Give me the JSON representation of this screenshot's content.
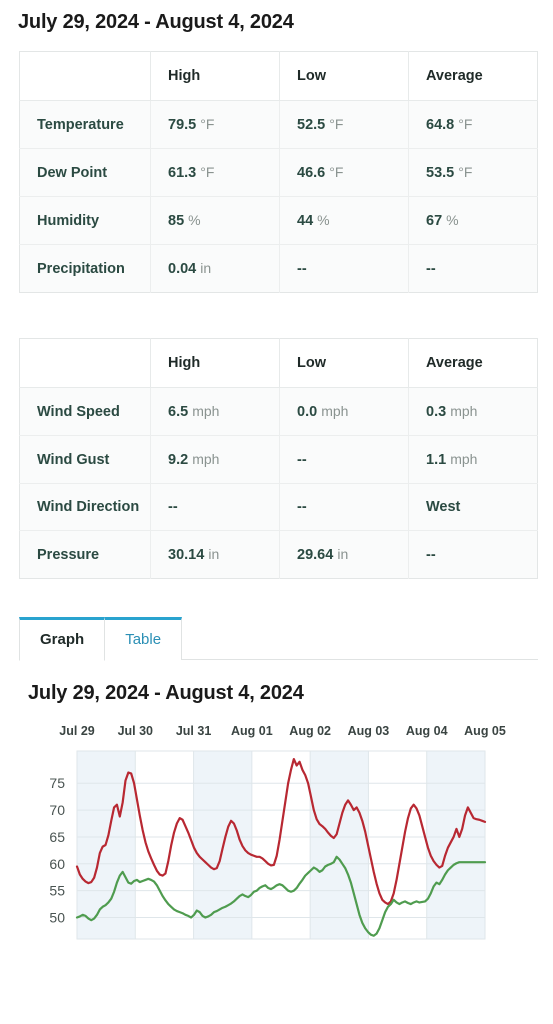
{
  "header": {
    "date_range": "July 29, 2024 - August 4, 2024"
  },
  "summary_table": {
    "columns": [
      "",
      "High",
      "Low",
      "Average"
    ],
    "rows": [
      {
        "label": "Temperature",
        "high_num": "79.5",
        "high_unit": "°F",
        "low_num": "52.5",
        "low_unit": "°F",
        "avg_num": "64.8",
        "avg_unit": "°F"
      },
      {
        "label": "Dew Point",
        "high_num": "61.3",
        "high_unit": "°F",
        "low_num": "46.6",
        "low_unit": "°F",
        "avg_num": "53.5",
        "avg_unit": "°F"
      },
      {
        "label": "Humidity",
        "high_num": "85",
        "high_unit": "%",
        "low_num": "44",
        "low_unit": "%",
        "avg_num": "67",
        "avg_unit": "%"
      },
      {
        "label": "Precipitation",
        "high_num": "0.04",
        "high_unit": "in",
        "low_num": "--",
        "low_unit": "",
        "avg_num": "--",
        "avg_unit": ""
      }
    ]
  },
  "wind_table": {
    "columns": [
      "",
      "High",
      "Low",
      "Average"
    ],
    "rows": [
      {
        "label": "Wind Speed",
        "high_num": "6.5",
        "high_unit": "mph",
        "low_num": "0.0",
        "low_unit": "mph",
        "avg_num": "0.3",
        "avg_unit": "mph"
      },
      {
        "label": "Wind Gust",
        "high_num": "9.2",
        "high_unit": "mph",
        "low_num": "--",
        "low_unit": "",
        "avg_num": "1.1",
        "avg_unit": "mph"
      },
      {
        "label": "Wind Direction",
        "high_num": "--",
        "high_unit": "",
        "low_num": "--",
        "low_unit": "",
        "avg_num": "West",
        "avg_unit": ""
      },
      {
        "label": "Pressure",
        "high_num": "30.14",
        "high_unit": "in",
        "low_num": "29.64",
        "low_unit": "in",
        "avg_num": "--",
        "avg_unit": ""
      }
    ]
  },
  "tabs": {
    "items": [
      {
        "label": "Graph",
        "active": true
      },
      {
        "label": "Table",
        "active": false
      }
    ],
    "accent_color": "#29a3cf"
  },
  "chart_data": {
    "type": "line",
    "title": "July 29, 2024 - August 4, 2024",
    "xlabel": "",
    "ylabel": "",
    "grid": true,
    "legend_position": "none",
    "axis_labels_position": "top",
    "xlim": [
      0,
      7
    ],
    "ylim": [
      46,
      81
    ],
    "yticks": [
      50,
      55,
      60,
      65,
      70,
      75
    ],
    "xtick_labels": [
      "Jul 29",
      "Jul 30",
      "Jul 31",
      "Aug 01",
      "Aug 02",
      "Aug 03",
      "Aug 04",
      "Aug 05"
    ],
    "day_band_count": 7,
    "series": [
      {
        "name": "Temperature",
        "color": "#b82832",
        "unit": "°F",
        "values": [
          59.5,
          58.0,
          57.2,
          56.7,
          56.4,
          56.6,
          57.4,
          59.3,
          62.0,
          63.2,
          63.5,
          65.3,
          68.0,
          70.5,
          71.0,
          68.8,
          71.4,
          75.5,
          77.0,
          76.8,
          75.0,
          72.0,
          69.0,
          66.3,
          64.0,
          62.3,
          61.0,
          59.8,
          58.7,
          58.0,
          57.8,
          58.2,
          60.5,
          63.4,
          65.8,
          67.5,
          68.5,
          68.2,
          67.0,
          65.8,
          64.4,
          63.0,
          62.0,
          61.3,
          60.8,
          60.3,
          59.8,
          59.3,
          59.0,
          59.2,
          60.5,
          62.8,
          65.0,
          66.9,
          68.0,
          67.5,
          66.2,
          64.5,
          63.3,
          62.5,
          62.0,
          61.7,
          61.5,
          61.3,
          61.3,
          61.0,
          60.5,
          60.0,
          59.7,
          59.8,
          61.5,
          64.5,
          68.0,
          71.5,
          75.0,
          77.5,
          79.5,
          78.3,
          79.0,
          77.5,
          76.5,
          75.0,
          72.5,
          70.0,
          68.3,
          67.4,
          67.0,
          66.5,
          65.8,
          65.2,
          64.8,
          65.5,
          67.5,
          69.5,
          71.0,
          71.8,
          71.0,
          70.0,
          70.5,
          69.5,
          68.0,
          66.0,
          63.5,
          61.0,
          58.5,
          56.3,
          54.5,
          53.3,
          52.8,
          52.5,
          53.0,
          54.5,
          57.0,
          60.0,
          63.0,
          66.0,
          68.5,
          70.3,
          71.0,
          70.3,
          69.0,
          67.0,
          65.0,
          63.0,
          61.5,
          60.5,
          59.8,
          59.3,
          59.6,
          61.5,
          63.0,
          64.0,
          65.0,
          66.5,
          65.0,
          66.5,
          69.0,
          70.5,
          69.5,
          68.5,
          68.3,
          68.2,
          68.0,
          67.8
        ]
      },
      {
        "name": "Dew Point",
        "color": "#4f9c4f",
        "unit": "°F",
        "values": [
          50.0,
          50.2,
          50.5,
          50.3,
          49.8,
          49.5,
          49.8,
          50.5,
          51.5,
          52.0,
          52.3,
          52.8,
          53.5,
          54.8,
          56.5,
          57.8,
          58.5,
          57.5,
          56.5,
          56.3,
          56.8,
          57.0,
          56.6,
          56.8,
          57.0,
          57.2,
          57.0,
          56.7,
          56.0,
          55.0,
          54.0,
          53.2,
          52.5,
          52.0,
          51.5,
          51.2,
          51.0,
          50.8,
          50.5,
          50.3,
          50.0,
          50.5,
          51.3,
          51.0,
          50.3,
          50.0,
          50.2,
          50.5,
          51.0,
          51.2,
          51.5,
          51.8,
          52.0,
          52.3,
          52.6,
          53.0,
          53.5,
          54.0,
          54.3,
          54.0,
          53.8,
          54.2,
          54.8,
          55.0,
          55.5,
          55.8,
          56.0,
          55.5,
          55.3,
          55.6,
          56.0,
          56.2,
          56.0,
          55.5,
          55.0,
          54.8,
          55.0,
          55.5,
          56.3,
          57.0,
          57.8,
          58.3,
          58.8,
          59.3,
          59.0,
          58.5,
          58.8,
          59.5,
          59.8,
          60.0,
          60.3,
          61.3,
          60.8,
          60.0,
          59.2,
          58.0,
          56.5,
          54.5,
          52.5,
          50.5,
          49.0,
          48.0,
          47.3,
          46.8,
          46.6,
          47.0,
          48.0,
          49.5,
          51.0,
          52.0,
          52.5,
          53.3,
          52.8,
          52.5,
          52.8,
          53.0,
          52.7,
          52.5,
          52.8,
          53.0,
          52.8,
          52.9,
          53.0,
          53.5,
          54.5,
          55.8,
          56.5,
          56.2,
          57.0,
          58.0,
          58.8,
          59.3,
          59.8,
          60.1,
          60.3,
          60.3,
          60.3,
          60.3,
          60.3,
          60.3,
          60.3,
          60.3,
          60.3,
          60.3
        ]
      }
    ]
  }
}
